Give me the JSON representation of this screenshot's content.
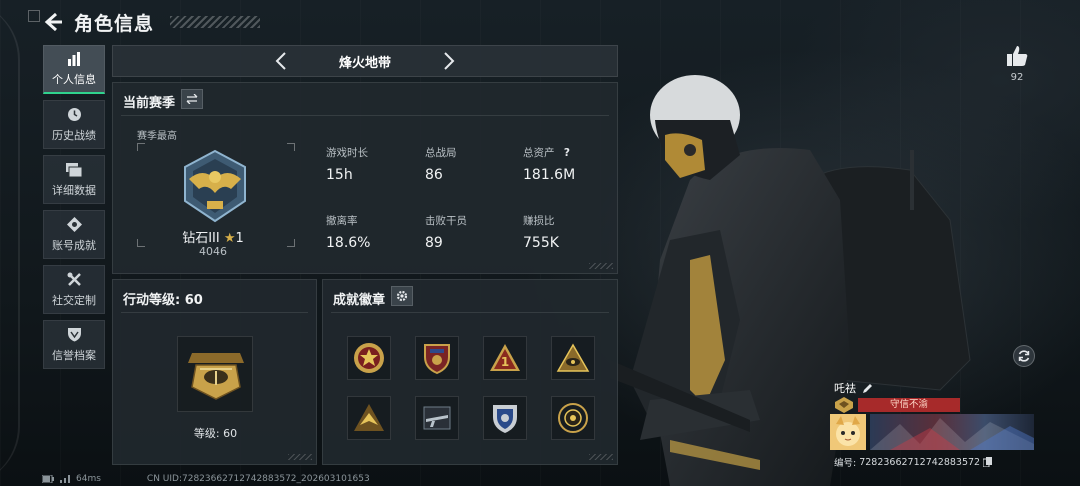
{
  "header": {
    "title": "角色信息"
  },
  "sidebar": {
    "items": [
      {
        "label": "个人信息",
        "icon": "bar-chart-icon",
        "active": true
      },
      {
        "label": "历史战绩",
        "icon": "history-icon",
        "active": false
      },
      {
        "label": "详细数据",
        "icon": "folder-icon",
        "active": false
      },
      {
        "label": "账号成就",
        "icon": "achievement-icon",
        "active": false
      },
      {
        "label": "社交定制",
        "icon": "tools-icon",
        "active": false
      },
      {
        "label": "信誉档案",
        "icon": "shield-icon",
        "active": false
      }
    ]
  },
  "season_nav": {
    "name": "烽火地带"
  },
  "current_season": {
    "title": "当前赛季",
    "season_best_label": "赛季最高",
    "rank_name": "钻石III",
    "rank_stars": "1",
    "rank_score": "4046",
    "stats": [
      {
        "label": "游戏时长",
        "value": "15h"
      },
      {
        "label": "总战局",
        "value": "86"
      },
      {
        "label": "总资产",
        "value": "181.6M"
      },
      {
        "label": "撤离率",
        "value": "18.6%"
      },
      {
        "label": "击败干员",
        "value": "89"
      },
      {
        "label": "赚损比",
        "value": "755K"
      }
    ]
  },
  "action_level": {
    "title_label": "行动等级:",
    "title_value": "60",
    "level_text": "等级: 60"
  },
  "badges": {
    "title": "成就徽章",
    "items": [
      "red-star-badge-icon",
      "shield-flag-badge-icon",
      "number-one-badge-icon",
      "eye-triangle-badge-icon",
      "bird-triangle-badge-icon",
      "rifle-badge-icon",
      "police-shield-badge-icon",
      "target-badge-icon"
    ]
  },
  "likes": {
    "count": "92"
  },
  "player_card": {
    "name": "吒祛",
    "tag": "守信不渝",
    "uid_label": "编号:",
    "uid": "72823662712742883572"
  },
  "footer": {
    "ping": "64ms",
    "uid_line": "CN UID:72823662712742883572_202603101653"
  },
  "colors": {
    "accent_green": "#2fd38e",
    "gold": "#d7b04a",
    "tag_red": "#a72a2a"
  }
}
